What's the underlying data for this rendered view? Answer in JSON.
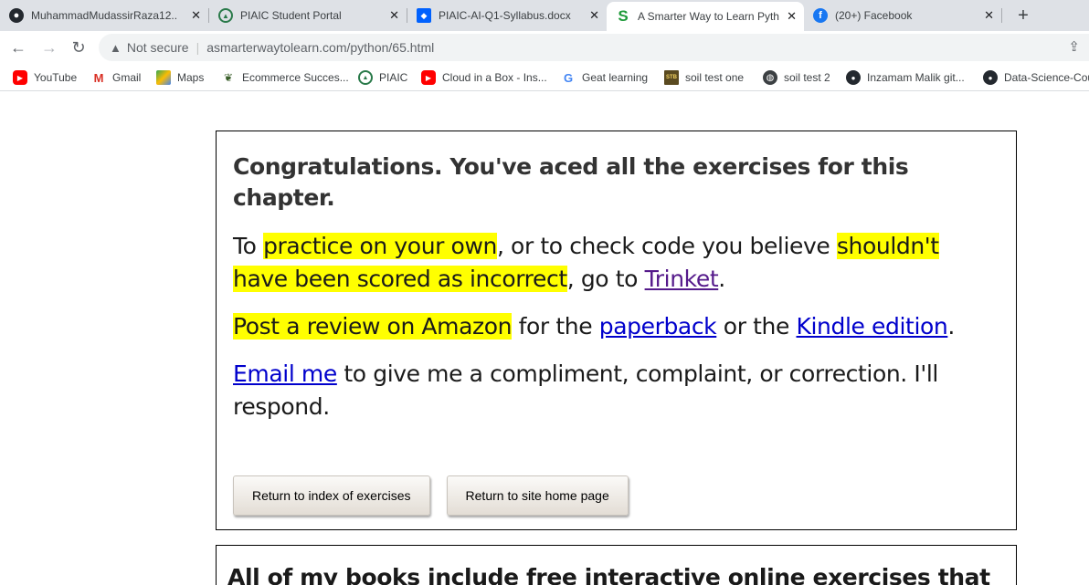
{
  "browser": {
    "tabs": [
      {
        "title": "MuhammadMudassirRaza12...",
        "icon": "github-icon",
        "active": false
      },
      {
        "title": "PIAIC Student Portal",
        "icon": "piaic-icon",
        "active": false
      },
      {
        "title": "PIAIC-AI-Q1-Syllabus.docx",
        "icon": "dropbox-icon",
        "active": false
      },
      {
        "title": "A Smarter Way to Learn Pyth",
        "icon": "smarter-way-icon",
        "active": true
      },
      {
        "title": "(20+) Facebook",
        "icon": "facebook-icon",
        "active": false
      }
    ],
    "tab_close": "✕",
    "new_tab": "+",
    "security_label": "Not secure",
    "url": "asmarterwaytolearn.com/python/65.html",
    "bookmarks": [
      {
        "label": "YouTube",
        "icon": "youtube-icon"
      },
      {
        "label": "Gmail",
        "icon": "gmail-icon"
      },
      {
        "label": "Maps",
        "icon": "maps-icon"
      },
      {
        "label": "Ecommerce Succes...",
        "icon": "ecommerce-icon"
      },
      {
        "label": "PIAIC",
        "icon": "piaic-icon"
      },
      {
        "label": "Cloud in a Box - Ins...",
        "icon": "youtube-icon"
      },
      {
        "label": "Geat learning",
        "icon": "google-icon"
      },
      {
        "label": "soil test one",
        "icon": "stb-icon"
      },
      {
        "label": "soil test 2",
        "icon": "globe-icon"
      },
      {
        "label": "Inzamam Malik git...",
        "icon": "github-icon"
      },
      {
        "label": "Data-Science-Cou...",
        "icon": "github-icon"
      }
    ]
  },
  "page": {
    "heading": "Congratulations. You've aced all the exercises for this chapter.",
    "p1": {
      "t1": "To ",
      "hl1": "practice on your own",
      "t2": ", or to check code you believe ",
      "hl2": "shouldn't have been scored as incorrect",
      "t3": ", go to ",
      "link": "Trinket",
      "t4": "."
    },
    "p2": {
      "hl": "Post a review on Amazon",
      "t1": " for the ",
      "link1": "paperback",
      "t2": " or the ",
      "link2": "Kindle edition",
      "t3": "."
    },
    "p3": {
      "link": "Email me",
      "t1": " to give me a compliment, complaint, or correction. I'll respond."
    },
    "buttons": {
      "index": "Return to index of exercises",
      "home": "Return to site home page"
    },
    "second_heading": "All of my books include free interactive online exercises that"
  }
}
